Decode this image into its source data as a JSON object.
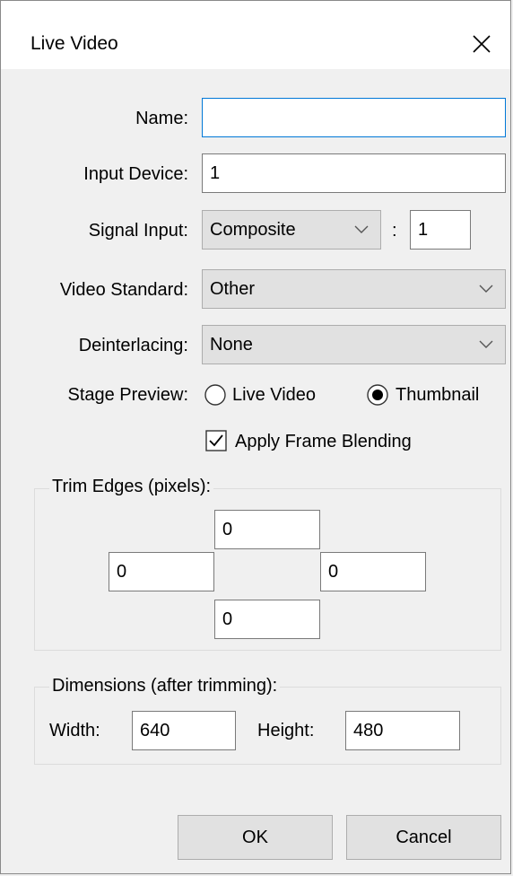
{
  "window": {
    "title": "Live Video"
  },
  "form": {
    "name": {
      "label": "Name:",
      "value": ""
    },
    "input_device": {
      "label": "Input Device:",
      "value": "1"
    },
    "signal_input": {
      "label": "Signal Input:",
      "selected": "Composite",
      "separator": ":",
      "index_value": "1"
    },
    "video_standard": {
      "label": "Video Standard:",
      "selected": "Other"
    },
    "deinterlacing": {
      "label": "Deinterlacing:",
      "selected": "None"
    },
    "stage_preview": {
      "label": "Stage Preview:",
      "options": [
        {
          "label": "Live Video",
          "selected": false
        },
        {
          "label": "Thumbnail",
          "selected": true
        }
      ]
    },
    "apply_frame_blending": {
      "label": "Apply Frame Blending",
      "checked": true
    }
  },
  "trim_edges": {
    "legend": "Trim Edges (pixels):",
    "top": "0",
    "left": "0",
    "right": "0",
    "bottom": "0"
  },
  "dimensions": {
    "legend": "Dimensions (after trimming):",
    "width_label": "Width:",
    "width_value": "640",
    "height_label": "Height:",
    "height_value": "480"
  },
  "buttons": {
    "ok": "OK",
    "cancel": "Cancel"
  },
  "icons": {
    "close": "close-icon",
    "dropdown": "chevron-down-icon"
  }
}
